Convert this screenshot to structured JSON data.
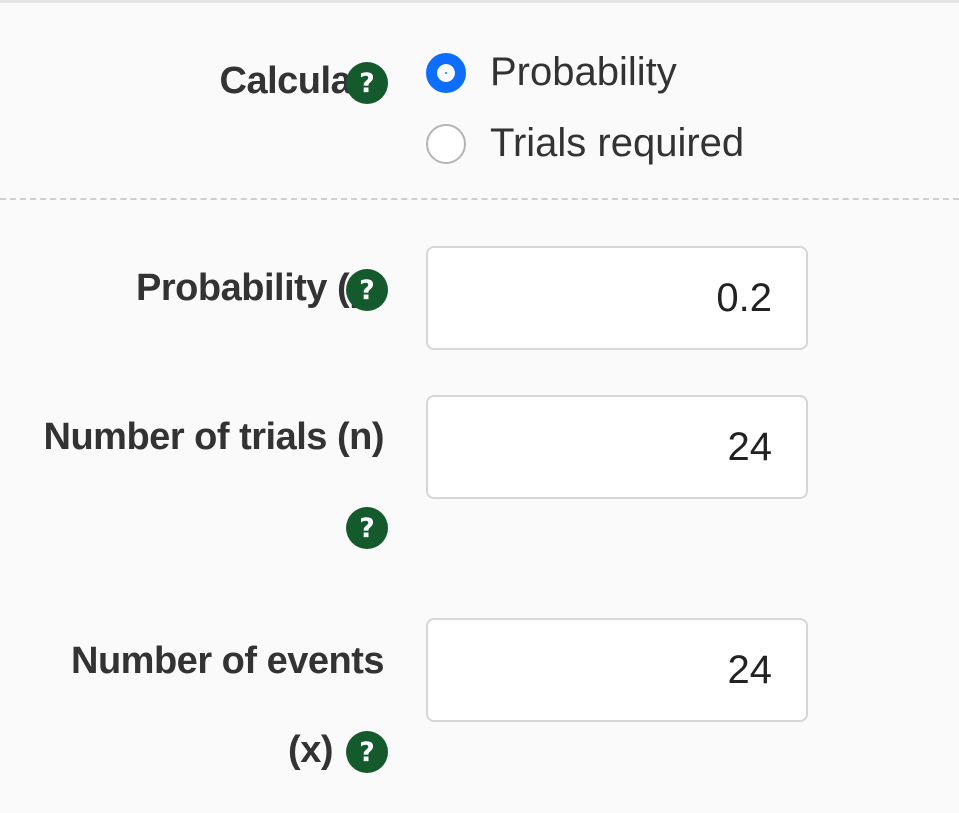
{
  "calculate": {
    "label": "Calculate",
    "help_icon": "?",
    "options": [
      {
        "label": "Probability",
        "selected": true
      },
      {
        "label": "Trials required",
        "selected": false
      }
    ]
  },
  "fields": {
    "probability": {
      "label": "Probability (p)",
      "value": "0.2",
      "help_icon": "?"
    },
    "trials": {
      "label": "Number of trials (n)",
      "value": "24",
      "help_icon": "?"
    },
    "events": {
      "label_line1": "Number of events",
      "label_line2": "(x)",
      "value": "24",
      "help_icon": "?"
    }
  },
  "colors": {
    "help_icon_bg": "#155a2c",
    "radio_selected": "#0d6efd"
  }
}
